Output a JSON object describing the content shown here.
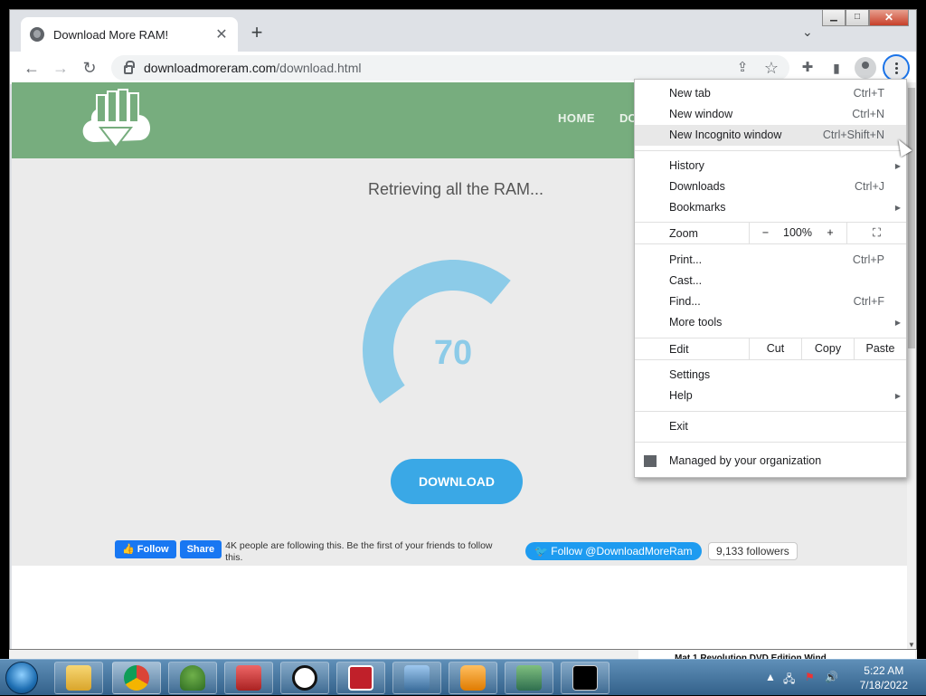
{
  "browser": {
    "tab_title": "Download More RAM!",
    "tab_close": "✕",
    "new_tab": "+",
    "tab_search": "⌄",
    "url_host": "downloadmoreram.com",
    "url_path": "/download.html",
    "window_buttons": {
      "minimize": "▁",
      "maximize": "□",
      "close": "✕"
    },
    "toolbar_icons": {
      "back": "←",
      "forward": "→",
      "reload": "↻",
      "share": "⇪",
      "star": "☆",
      "extensions": "✚",
      "sidepanel": "▮"
    }
  },
  "page": {
    "nav_home": "HOME",
    "nav_partial": "DO",
    "heading": "Retrieving all the RAM...",
    "progress_value": "70",
    "progress_fraction": 0.7,
    "download_button": "DOWNLOAD",
    "fb_follow": "Follow",
    "fb_share": "Share",
    "fb_text": "4K people are following this. Be the first of your friends to follow this.",
    "twitter_follow": "Follow @DownloadMoreRam",
    "twitter_count": "9,133 followers",
    "colors": {
      "header": "#77ad7e",
      "gauge": "#8ccbe8",
      "button": "#3aa8e6"
    }
  },
  "menu": {
    "new_tab": {
      "label": "New tab",
      "key": "Ctrl+T"
    },
    "new_window": {
      "label": "New window",
      "key": "Ctrl+N"
    },
    "incognito": {
      "label": "New Incognito window",
      "key": "Ctrl+Shift+N"
    },
    "history": {
      "label": "History"
    },
    "downloads": {
      "label": "Downloads",
      "key": "Ctrl+J"
    },
    "bookmarks": {
      "label": "Bookmarks"
    },
    "zoom": {
      "label": "Zoom",
      "minus": "−",
      "value": "100%",
      "plus": "+",
      "fullscreen": "⛶"
    },
    "print": {
      "label": "Print...",
      "key": "Ctrl+P"
    },
    "cast": {
      "label": "Cast..."
    },
    "find": {
      "label": "Find...",
      "key": "Ctrl+F"
    },
    "more_tools": {
      "label": "More tools"
    },
    "edit": {
      "label": "Edit",
      "cut": "Cut",
      "copy": "Copy",
      "paste": "Paste"
    },
    "settings": {
      "label": "Settings"
    },
    "help": {
      "label": "Help"
    },
    "exit": {
      "label": "Exit"
    },
    "managed": {
      "label": "Managed by your organization"
    },
    "submenu_arrow": "▶"
  },
  "behind_text": "Mat 1 Revolution DVD Edition Wind",
  "taskbar": {
    "time": "5:22 AM",
    "date": "7/18/2022",
    "tray_up": "▲",
    "tray_net": "🖧",
    "tray_flag": "⚑",
    "tray_vol": "🔊"
  }
}
